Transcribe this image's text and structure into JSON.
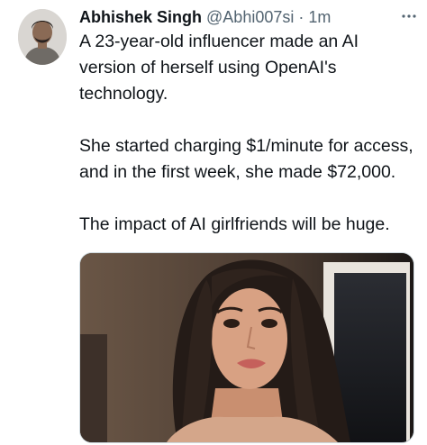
{
  "tweet": {
    "author": {
      "name": "Abhishek Singh",
      "handle": "@Abhi007si",
      "separator": "·",
      "time": "1m"
    },
    "paragraphs": [
      "A 23-year-old influencer made an AI version of herself using OpenAI's technology.",
      "She started charging $1/minute for access, and in the first week, she made $72,000.",
      "The impact of AI girlfriends will be huge."
    ],
    "avatar_icon": "user-avatar",
    "more_icon": "more-options-icon",
    "media_icon": "photo-of-woman"
  }
}
